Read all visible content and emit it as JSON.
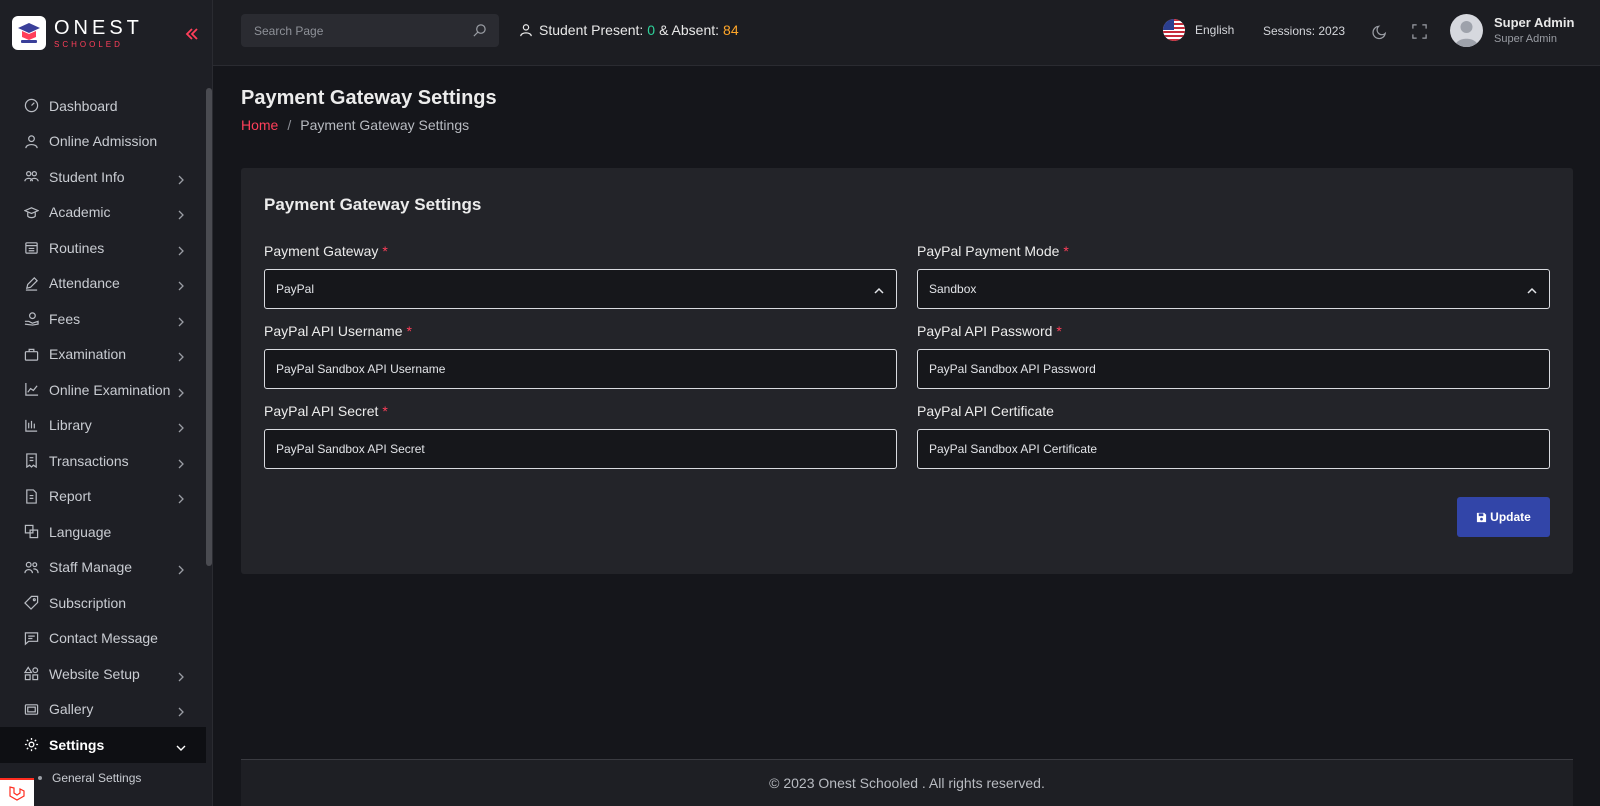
{
  "brand": {
    "name": "ONEST",
    "tagline": "SCHOOLED"
  },
  "sidebar": {
    "items": [
      {
        "label": "Dashboard",
        "icon": "dashboard-icon",
        "has_children": false
      },
      {
        "label": "Online Admission",
        "icon": "user-icon",
        "has_children": false
      },
      {
        "label": "Student Info",
        "icon": "students-icon",
        "has_children": true
      },
      {
        "label": "Academic",
        "icon": "graduation-cap-icon",
        "has_children": true
      },
      {
        "label": "Routines",
        "icon": "calendar-icon",
        "has_children": true
      },
      {
        "label": "Attendance",
        "icon": "pen-icon",
        "has_children": true
      },
      {
        "label": "Fees",
        "icon": "money-hand-icon",
        "has_children": true
      },
      {
        "label": "Examination",
        "icon": "briefcase-icon",
        "has_children": true
      },
      {
        "label": "Online Examination",
        "icon": "chart-icon",
        "has_children": true
      },
      {
        "label": "Library",
        "icon": "book-icon",
        "has_children": true
      },
      {
        "label": "Transactions",
        "icon": "receipt-icon",
        "has_children": true
      },
      {
        "label": "Report",
        "icon": "document-icon",
        "has_children": true
      },
      {
        "label": "Language",
        "icon": "translate-icon",
        "has_children": false
      },
      {
        "label": "Staff Manage",
        "icon": "staff-icon",
        "has_children": true
      },
      {
        "label": "Subscription",
        "icon": "tag-icon",
        "has_children": false
      },
      {
        "label": "Contact Message",
        "icon": "message-icon",
        "has_children": false
      },
      {
        "label": "Website Setup",
        "icon": "shapes-icon",
        "has_children": true
      },
      {
        "label": "Gallery",
        "icon": "gallery-icon",
        "has_children": true
      },
      {
        "label": "Settings",
        "icon": "gear-icon",
        "has_children": true,
        "active": true
      }
    ],
    "sub_items": [
      {
        "label": "General Settings"
      }
    ]
  },
  "topbar": {
    "search_placeholder": "Search Page",
    "attendance": {
      "present_label": "Student Present:",
      "present": "0",
      "joiner": "& Absent:",
      "absent": "84"
    },
    "language": "English",
    "sessions": "Sessions: 2023",
    "user": {
      "name": "Super Admin",
      "role": "Super Admin"
    }
  },
  "page": {
    "title": "Payment Gateway Settings",
    "breadcrumb": {
      "home": "Home",
      "separator": "/",
      "current": "Payment Gateway Settings"
    }
  },
  "form": {
    "title": "Payment Gateway Settings",
    "fields": {
      "gateway": {
        "label": "Payment Gateway",
        "required": "*",
        "value": "PayPal"
      },
      "mode": {
        "label": "PayPal Payment Mode",
        "required": "*",
        "value": "Sandbox"
      },
      "username": {
        "label": "PayPal API Username",
        "required": "*",
        "value": "PayPal Sandbox API Username"
      },
      "password": {
        "label": "PayPal API Password",
        "required": "*",
        "value": "PayPal Sandbox API Password"
      },
      "secret": {
        "label": "PayPal API Secret",
        "required": "*",
        "value": "PayPal Sandbox API Secret"
      },
      "certificate": {
        "label": "PayPal API Certificate",
        "value": "PayPal Sandbox API Certificate"
      }
    },
    "submit_label": "Update"
  },
  "footer": {
    "text": "© 2023 Onest Schooled . All rights reserved."
  },
  "colors": {
    "accent": "#ff3f5a",
    "primary_button": "#3245a8",
    "present": "#2ed19a",
    "absent": "#ffa629"
  }
}
